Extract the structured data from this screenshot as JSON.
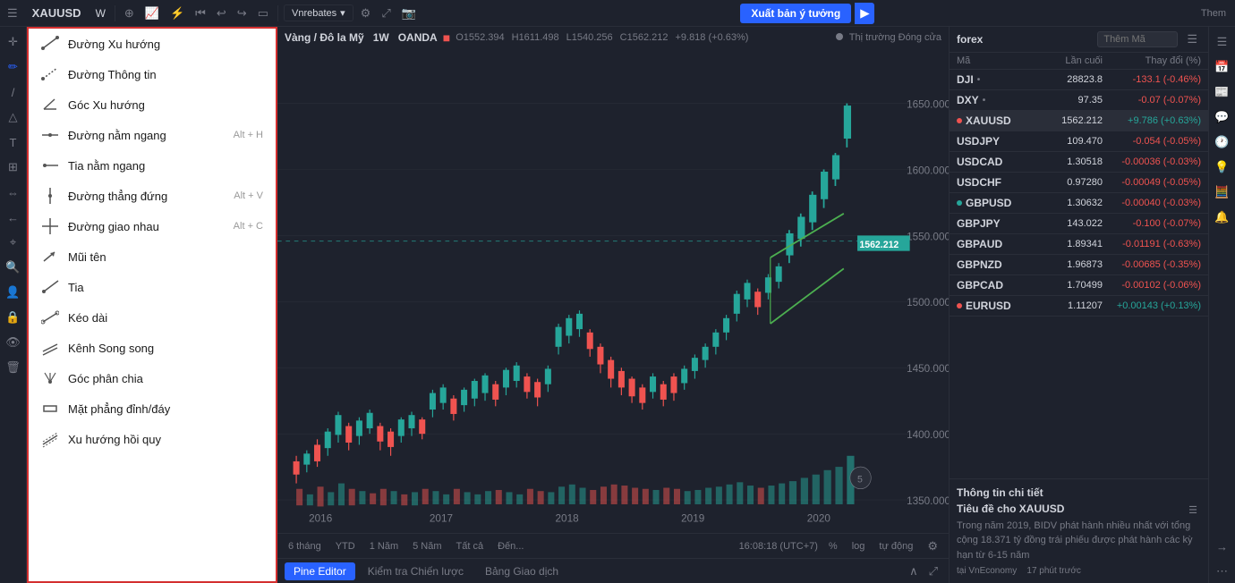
{
  "topbar": {
    "symbol": "XAUUSD",
    "timeframe": "W",
    "vnrebates": "Vnrebates",
    "publish_label": "Xuất bản ý tưởng",
    "theme_label": "Them"
  },
  "chart_header": {
    "pair": "Vàng / Đô la Mỹ",
    "timeframe": "1W",
    "broker": "OANDA",
    "open": "O1552.394",
    "high": "H1611.498",
    "low": "L1540.256",
    "close": "C1562.212",
    "change": "+9.818 (+0.63%)",
    "market_status": "Thị trường Đóng cửa",
    "current_price": "1562.212"
  },
  "time_buttons": [
    "6 tháng",
    "YTD",
    "1 Năm",
    "5 Năm",
    "Tất cả",
    "Đến..."
  ],
  "bottom_info": "16:08:18 (UTC+7)",
  "bottom_tabs": [
    "Pine Editor",
    "Kiểm tra Chiến lược",
    "Bảng Giao dịch"
  ],
  "drawing_tools": [
    {
      "label": "Đường Xu hướng",
      "shortcut": "",
      "icon": "trend"
    },
    {
      "label": "Đường Thông tin",
      "shortcut": "",
      "icon": "info-line"
    },
    {
      "label": "Góc Xu hướng",
      "shortcut": "",
      "icon": "angle"
    },
    {
      "label": "Đường nằm ngang",
      "shortcut": "Alt + H",
      "icon": "hline"
    },
    {
      "label": "Tia nằm ngang",
      "shortcut": "",
      "icon": "ray-h"
    },
    {
      "label": "Đường thẳng đứng",
      "shortcut": "Alt + V",
      "icon": "vline"
    },
    {
      "label": "Đường giao nhau",
      "shortcut": "Alt + C",
      "icon": "cross"
    },
    {
      "label": "Mũi tên",
      "shortcut": "",
      "icon": "arrow"
    },
    {
      "label": "Tia",
      "shortcut": "",
      "icon": "ray"
    },
    {
      "label": "Kéo dài",
      "shortcut": "",
      "icon": "extend"
    },
    {
      "label": "Kênh Song song",
      "shortcut": "",
      "icon": "parallel"
    },
    {
      "label": "Góc phân chia",
      "shortcut": "",
      "icon": "fork"
    },
    {
      "label": "Mặt phẳng đỉnh/đáy",
      "shortcut": "",
      "icon": "flat"
    },
    {
      "label": "Xu hướng hồi quy",
      "shortcut": "",
      "icon": "regression"
    }
  ],
  "watchlist": {
    "title": "forex",
    "search_placeholder": "Thêm Mã",
    "headers": {
      "symbol": "Mã",
      "last": "Lần cuối",
      "change": "Thay đổi (%)"
    },
    "items": [
      {
        "symbol": "DJI",
        "dot": "none",
        "last": "28823.8",
        "change": "-133.1 (-0.46%)",
        "dir": "neg"
      },
      {
        "symbol": "DXY",
        "dot": "none",
        "last": "97.35",
        "change": "-0.07 (-0.07%)",
        "dir": "neg"
      },
      {
        "symbol": "XAUUSD",
        "dot": "red",
        "last": "1562.212",
        "change": "+9.786 (+0.63%)",
        "dir": "pos"
      },
      {
        "symbol": "USDJPY",
        "dot": "none",
        "last": "109.470",
        "change": "-0.054 (-0.05%)",
        "dir": "neg"
      },
      {
        "symbol": "USDCAD",
        "dot": "none",
        "last": "1.30518",
        "change": "-0.00036 (-0.03%)",
        "dir": "neg"
      },
      {
        "symbol": "USDCHF",
        "dot": "none",
        "last": "0.97280",
        "change": "-0.00049 (-0.05%)",
        "dir": "neg"
      },
      {
        "symbol": "GBPUSD",
        "dot": "green",
        "last": "1.30632",
        "change": "-0.00040 (-0.03%)",
        "dir": "neg"
      },
      {
        "symbol": "GBPJPY",
        "dot": "none",
        "last": "143.022",
        "change": "-0.100 (-0.07%)",
        "dir": "neg"
      },
      {
        "symbol": "GBPAUD",
        "dot": "none",
        "last": "1.89341",
        "change": "-0.01191 (-0.63%)",
        "dir": "neg"
      },
      {
        "symbol": "GBPNZD",
        "dot": "none",
        "last": "1.96873",
        "change": "-0.00685 (-0.35%)",
        "dir": "neg"
      },
      {
        "symbol": "GBPCAD",
        "dot": "none",
        "last": "1.70499",
        "change": "-0.00102 (-0.06%)",
        "dir": "neg"
      },
      {
        "symbol": "EURUSD",
        "dot": "red",
        "last": "1.11207",
        "change": "+0.00143 (+0.13%)",
        "dir": "pos"
      }
    ]
  },
  "detail": {
    "section_title": "Thông tin chi tiết",
    "subtitle": "Tiêu đề cho XAUUSD",
    "text": "Trong năm 2019, BIDV phát hành nhiều nhất với tổng cộng 18.371 tỷ đồng trái phiếu được phát hành các kỳ hạn từ 6-15 năm",
    "source": "tại VnEconomy",
    "time_ago": "17 phút trước"
  }
}
